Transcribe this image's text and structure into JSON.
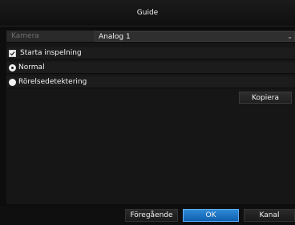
{
  "window": {
    "title": "Guide"
  },
  "form": {
    "camera_label": "Kamera",
    "camera_value": "Analog 1",
    "start_recording_label": "Starta inspelning",
    "start_recording_checked": true,
    "radio_normal_label": "Normal",
    "radio_normal_selected": true,
    "radio_motion_label": "Rörelsedetektering",
    "radio_motion_selected": false,
    "copy_button_label": "Kopiera"
  },
  "footer": {
    "previous_label": "Föregående",
    "ok_label": "OK",
    "channel_label": "Kanal"
  },
  "icons": {
    "dropdown": "chevron-down-icon",
    "checkbox": "check-icon"
  }
}
